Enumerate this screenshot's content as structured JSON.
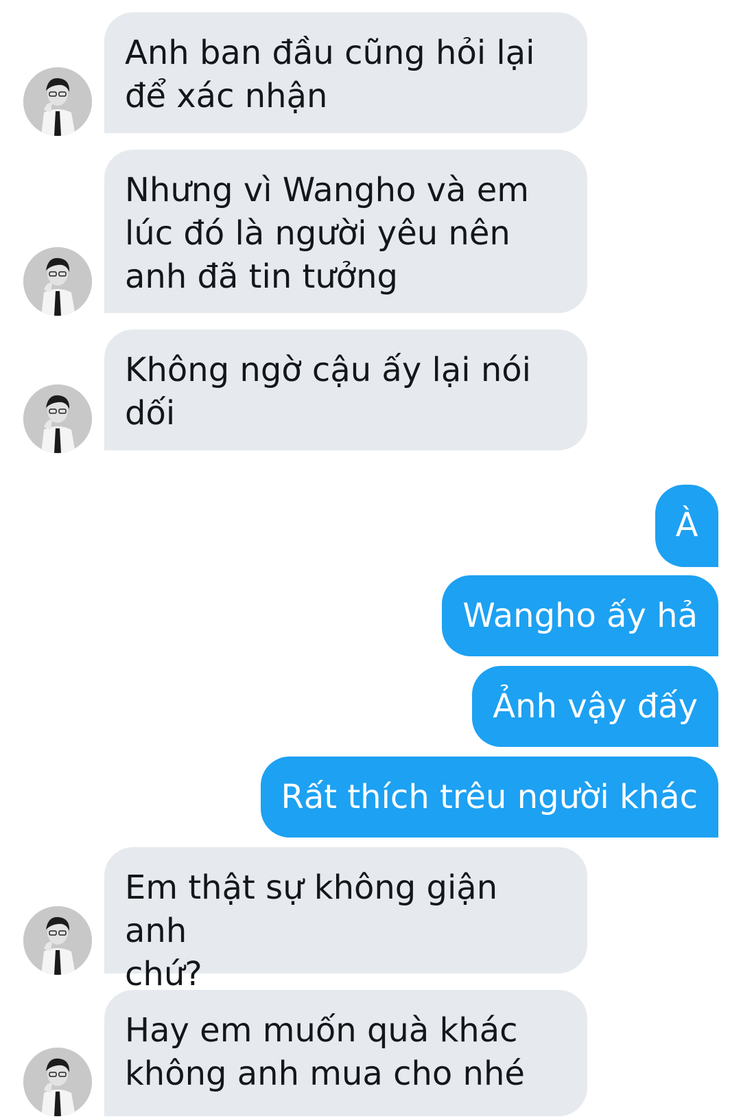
{
  "conversation": {
    "messages": [
      {
        "direction": "incoming",
        "text": "Anh ban đầu cũng hỏi lại\nđể xác nhận"
      },
      {
        "direction": "incoming",
        "text": "Nhưng vì Wangho và em\nlúc đó là người yêu nên\nanh đã tin tưởng"
      },
      {
        "direction": "incoming",
        "text": "Không ngờ cậu ấy lại nói\ndối"
      },
      {
        "direction": "outgoing",
        "text": "À"
      },
      {
        "direction": "outgoing",
        "text": "Wangho ấy hả"
      },
      {
        "direction": "outgoing",
        "text": "Ảnh vậy đấy"
      },
      {
        "direction": "outgoing",
        "text": "Rất thích trêu người khác"
      },
      {
        "direction": "incoming",
        "text": "Em thật sự không giận anh\nchứ?"
      },
      {
        "direction": "incoming",
        "text": "Hay em muốn quà khác\nkhông anh mua cho nhé"
      }
    ]
  },
  "colors": {
    "incoming_bubble": "#e6eaee",
    "outgoing_bubble": "#1da1f2",
    "incoming_text": "#14171a",
    "outgoing_text": "#ffffff"
  },
  "icons": {
    "contact_avatar": "avatar-photo-icon"
  }
}
